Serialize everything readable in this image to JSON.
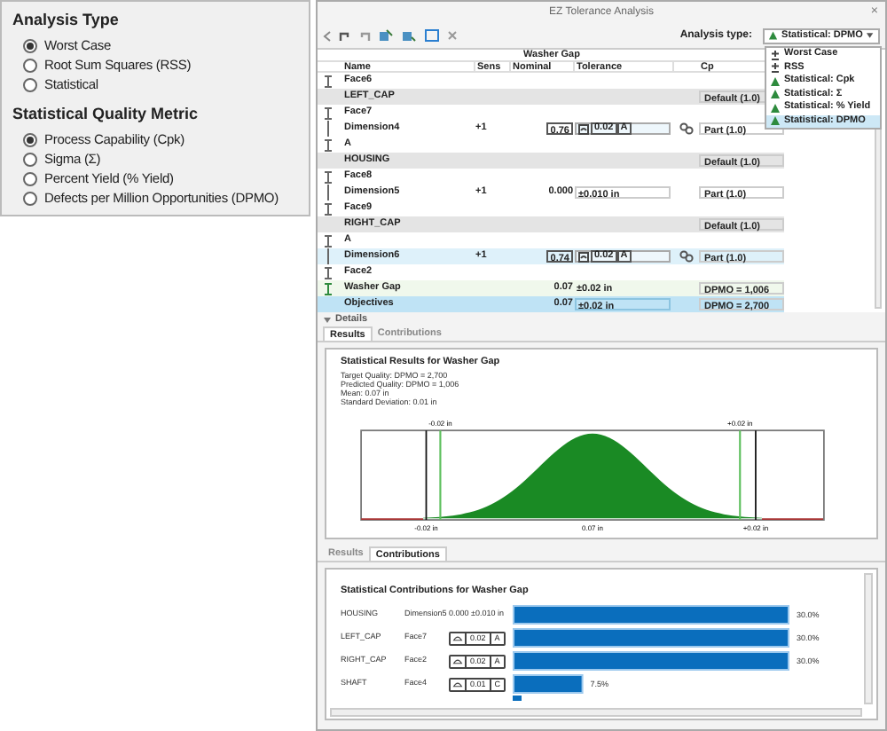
{
  "left_panel": {
    "groups": [
      {
        "heading": "Analysis Type",
        "options": [
          {
            "label": "Worst Case",
            "selected": true
          },
          {
            "label": "Root Sum Squares (RSS)",
            "selected": false
          },
          {
            "label": "Statistical",
            "selected": false
          }
        ]
      },
      {
        "heading": "Statistical Quality Metric",
        "options": [
          {
            "label": "Process Capability (Cpk)",
            "selected": true
          },
          {
            "label": "Sigma (Σ)",
            "selected": false
          },
          {
            "label": "Percent Yield (% Yield)",
            "selected": false
          },
          {
            "label": "Defects per Million Opportunities (DPMO)",
            "selected": false
          }
        ]
      }
    ]
  },
  "window": {
    "title": "EZ Tolerance Analysis",
    "close": "×"
  },
  "toolbar": {
    "analysis_type_label": "Analysis type:",
    "analysis_type_value": "Statistical: DPMO",
    "dropdown_options": [
      {
        "label": "Worst Case",
        "kind": "plusminus",
        "selected": false
      },
      {
        "label": "RSS",
        "kind": "plusminus",
        "selected": false
      },
      {
        "label": "Statistical: Cpk",
        "kind": "statistical",
        "selected": false
      },
      {
        "label": "Statistical: Σ",
        "kind": "statistical",
        "selected": false
      },
      {
        "label": "Statistical: % Yield",
        "kind": "statistical",
        "selected": false
      },
      {
        "label": "Statistical: DPMO",
        "kind": "statistical",
        "selected": true
      }
    ]
  },
  "table": {
    "title": "Washer Gap",
    "columns": [
      "Name",
      "Sens",
      "Nominal",
      "Tolerance",
      "Cp"
    ],
    "rows": [
      {
        "kind": "feature",
        "name": "Face6",
        "selected": false
      },
      {
        "kind": "group",
        "name": "LEFT_CAP",
        "cp": "Default (1.0)",
        "selected": false
      },
      {
        "kind": "feature",
        "name": "Face7",
        "selected": false
      },
      {
        "kind": "dimension",
        "name": "Dimension4",
        "sens": "+1",
        "nominal": "0.76",
        "boxed": true,
        "tolerance": "0.02",
        "datum": "A",
        "linked": true,
        "cp": "Part (1.0)",
        "selected": false
      },
      {
        "kind": "feature",
        "name": "A",
        "selected": false
      },
      {
        "kind": "group",
        "name": "HOUSING",
        "cp": "Default (1.0)",
        "selected": false
      },
      {
        "kind": "feature",
        "name": "Face8",
        "selected": false
      },
      {
        "kind": "dimension",
        "name": "Dimension5",
        "sens": "+1",
        "nominal": "0.000",
        "boxed": false,
        "tolerance": "±0.010 in",
        "linked": false,
        "cp": "Part (1.0)",
        "selected": false
      },
      {
        "kind": "feature",
        "name": "Face9",
        "selected": false
      },
      {
        "kind": "group",
        "name": "RIGHT_CAP",
        "cp": "Default (1.0)",
        "selected": false
      },
      {
        "kind": "feature",
        "name": "A",
        "selected": false
      },
      {
        "kind": "dimension",
        "name": "Dimension6",
        "sens": "+1",
        "nominal": "0.74",
        "boxed": true,
        "tolerance": "0.02",
        "datum": "A",
        "linked": true,
        "cp": "Part (1.0)",
        "selected": true
      },
      {
        "kind": "feature",
        "name": "Face2",
        "selected": false
      },
      {
        "kind": "result",
        "name": "Washer Gap",
        "nominal": "0.07",
        "tolerance": "±0.02 in",
        "cp": "DPMO = 1,006",
        "selected": false
      },
      {
        "kind": "objective",
        "name": "Objectives",
        "nominal": "0.07",
        "tolerance": "±0.02 in",
        "cp": "DPMO = 2,700",
        "selected": false
      }
    ]
  },
  "details": {
    "label": "Details",
    "expanded": true
  },
  "results_tabs": [
    {
      "label": "Results",
      "selected": true
    },
    {
      "label": "Contributions",
      "selected": false
    }
  ],
  "results": {
    "title": "Statistical Results for Washer Gap",
    "lines": [
      "Target Quality: DPMO = 2,700",
      "Predicted Quality: DPMO = 1,006",
      "Mean: 0.07 in",
      "Standard Deviation: 0.01 in"
    ],
    "top_labels": [
      "-0.02 in",
      "+0.02 in"
    ],
    "bottom_labels": [
      "-0.02 in",
      "0.07 in",
      "+0.02 in"
    ]
  },
  "contributions_tabs": [
    {
      "label": "Results",
      "selected": false
    },
    {
      "label": "Contributions",
      "selected": true
    }
  ],
  "contributions": {
    "title": "Statistical Contributions for Washer Gap",
    "rows": [
      {
        "kind": "dimension",
        "feature": "Dimension5",
        "tolerance": "0.000 ±0.010 in"
      },
      {
        "kind": "frame",
        "feature": "Face7",
        "tolerance": "0.02",
        "datum": "A"
      },
      {
        "kind": "frame",
        "feature": "Face2",
        "tolerance": "0.02",
        "datum": "A"
      },
      {
        "kind": "frame",
        "feature": "Face4",
        "tolerance": "0.01",
        "datum": "C"
      }
    ],
    "chart_data": {
      "type": "bar",
      "orientation": "horizontal",
      "categories": [
        "HOUSING",
        "LEFT_CAP",
        "RIGHT_CAP",
        "SHAFT"
      ],
      "values": [
        30,
        30,
        30,
        7.5
      ],
      "value_labels": [
        "30.0%",
        "30.0%",
        "30.0%",
        "7.5%"
      ]
    }
  }
}
